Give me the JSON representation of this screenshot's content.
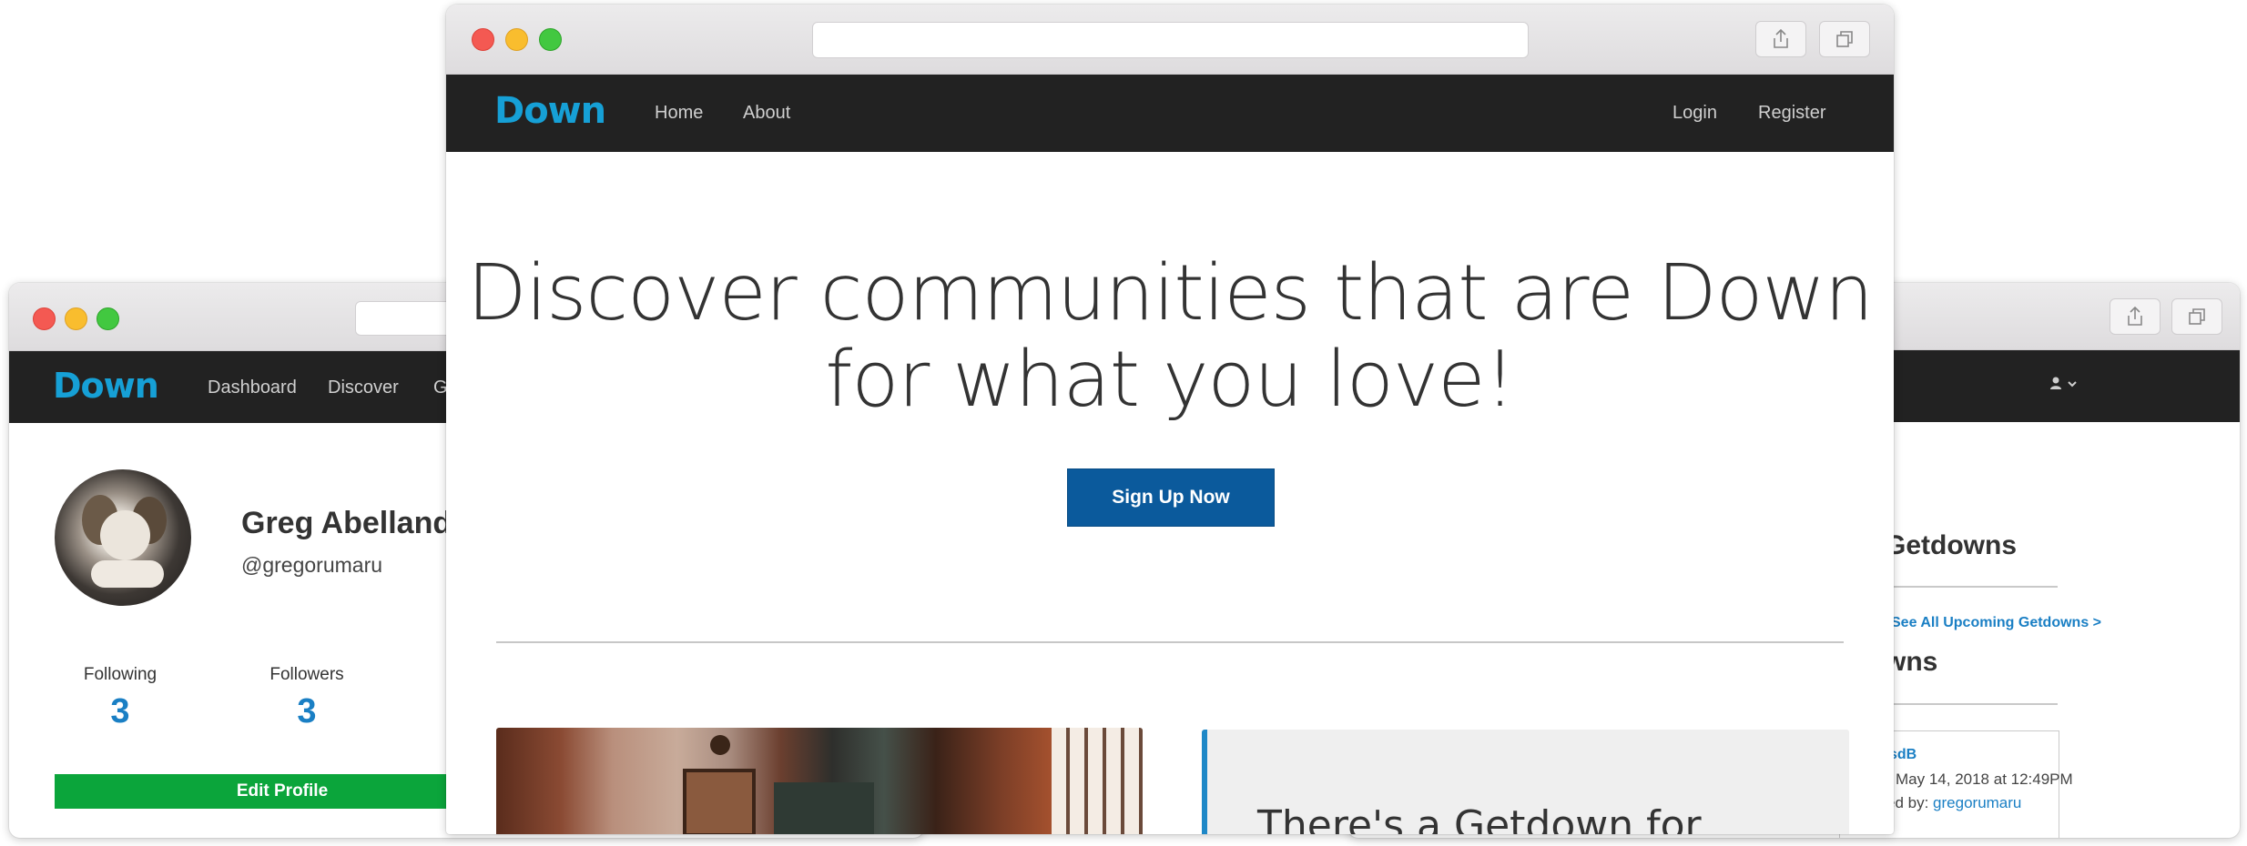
{
  "left_window": {
    "logo": "Down",
    "nav": [
      "Dashboard",
      "Discover",
      "G"
    ],
    "profile": {
      "name": "Greg Abelland",
      "handle": "@gregorumaru",
      "following_label": "Following",
      "following_count": "3",
      "followers_label": "Followers",
      "followers_count": "3",
      "edit_label": "Edit Profile"
    }
  },
  "center_window": {
    "logo": "Down",
    "nav_left": [
      "Home",
      "About"
    ],
    "nav_right": [
      "Login",
      "Register"
    ],
    "hero_line1": "Discover communities that are Down",
    "hero_line2": "for what you love!",
    "signup_label": "Sign Up Now",
    "card_title": "There's a Getdown for"
  },
  "right_window": {
    "section1_title": "Getdowns",
    "see_all_link": "See All Upcoming Getdowns >",
    "section2_title": "wns",
    "item_title": "sdB",
    "item_date": "May 14, 2018 at 12:49PM",
    "item_by_prefix": "ed by:",
    "item_by_user": "gregorumaru"
  },
  "colors": {
    "navbar": "#222222",
    "logo": "#16a0d6",
    "primary_button": "#0b5a9c",
    "success_button": "#0ba53b",
    "link": "#1a7fc4"
  }
}
